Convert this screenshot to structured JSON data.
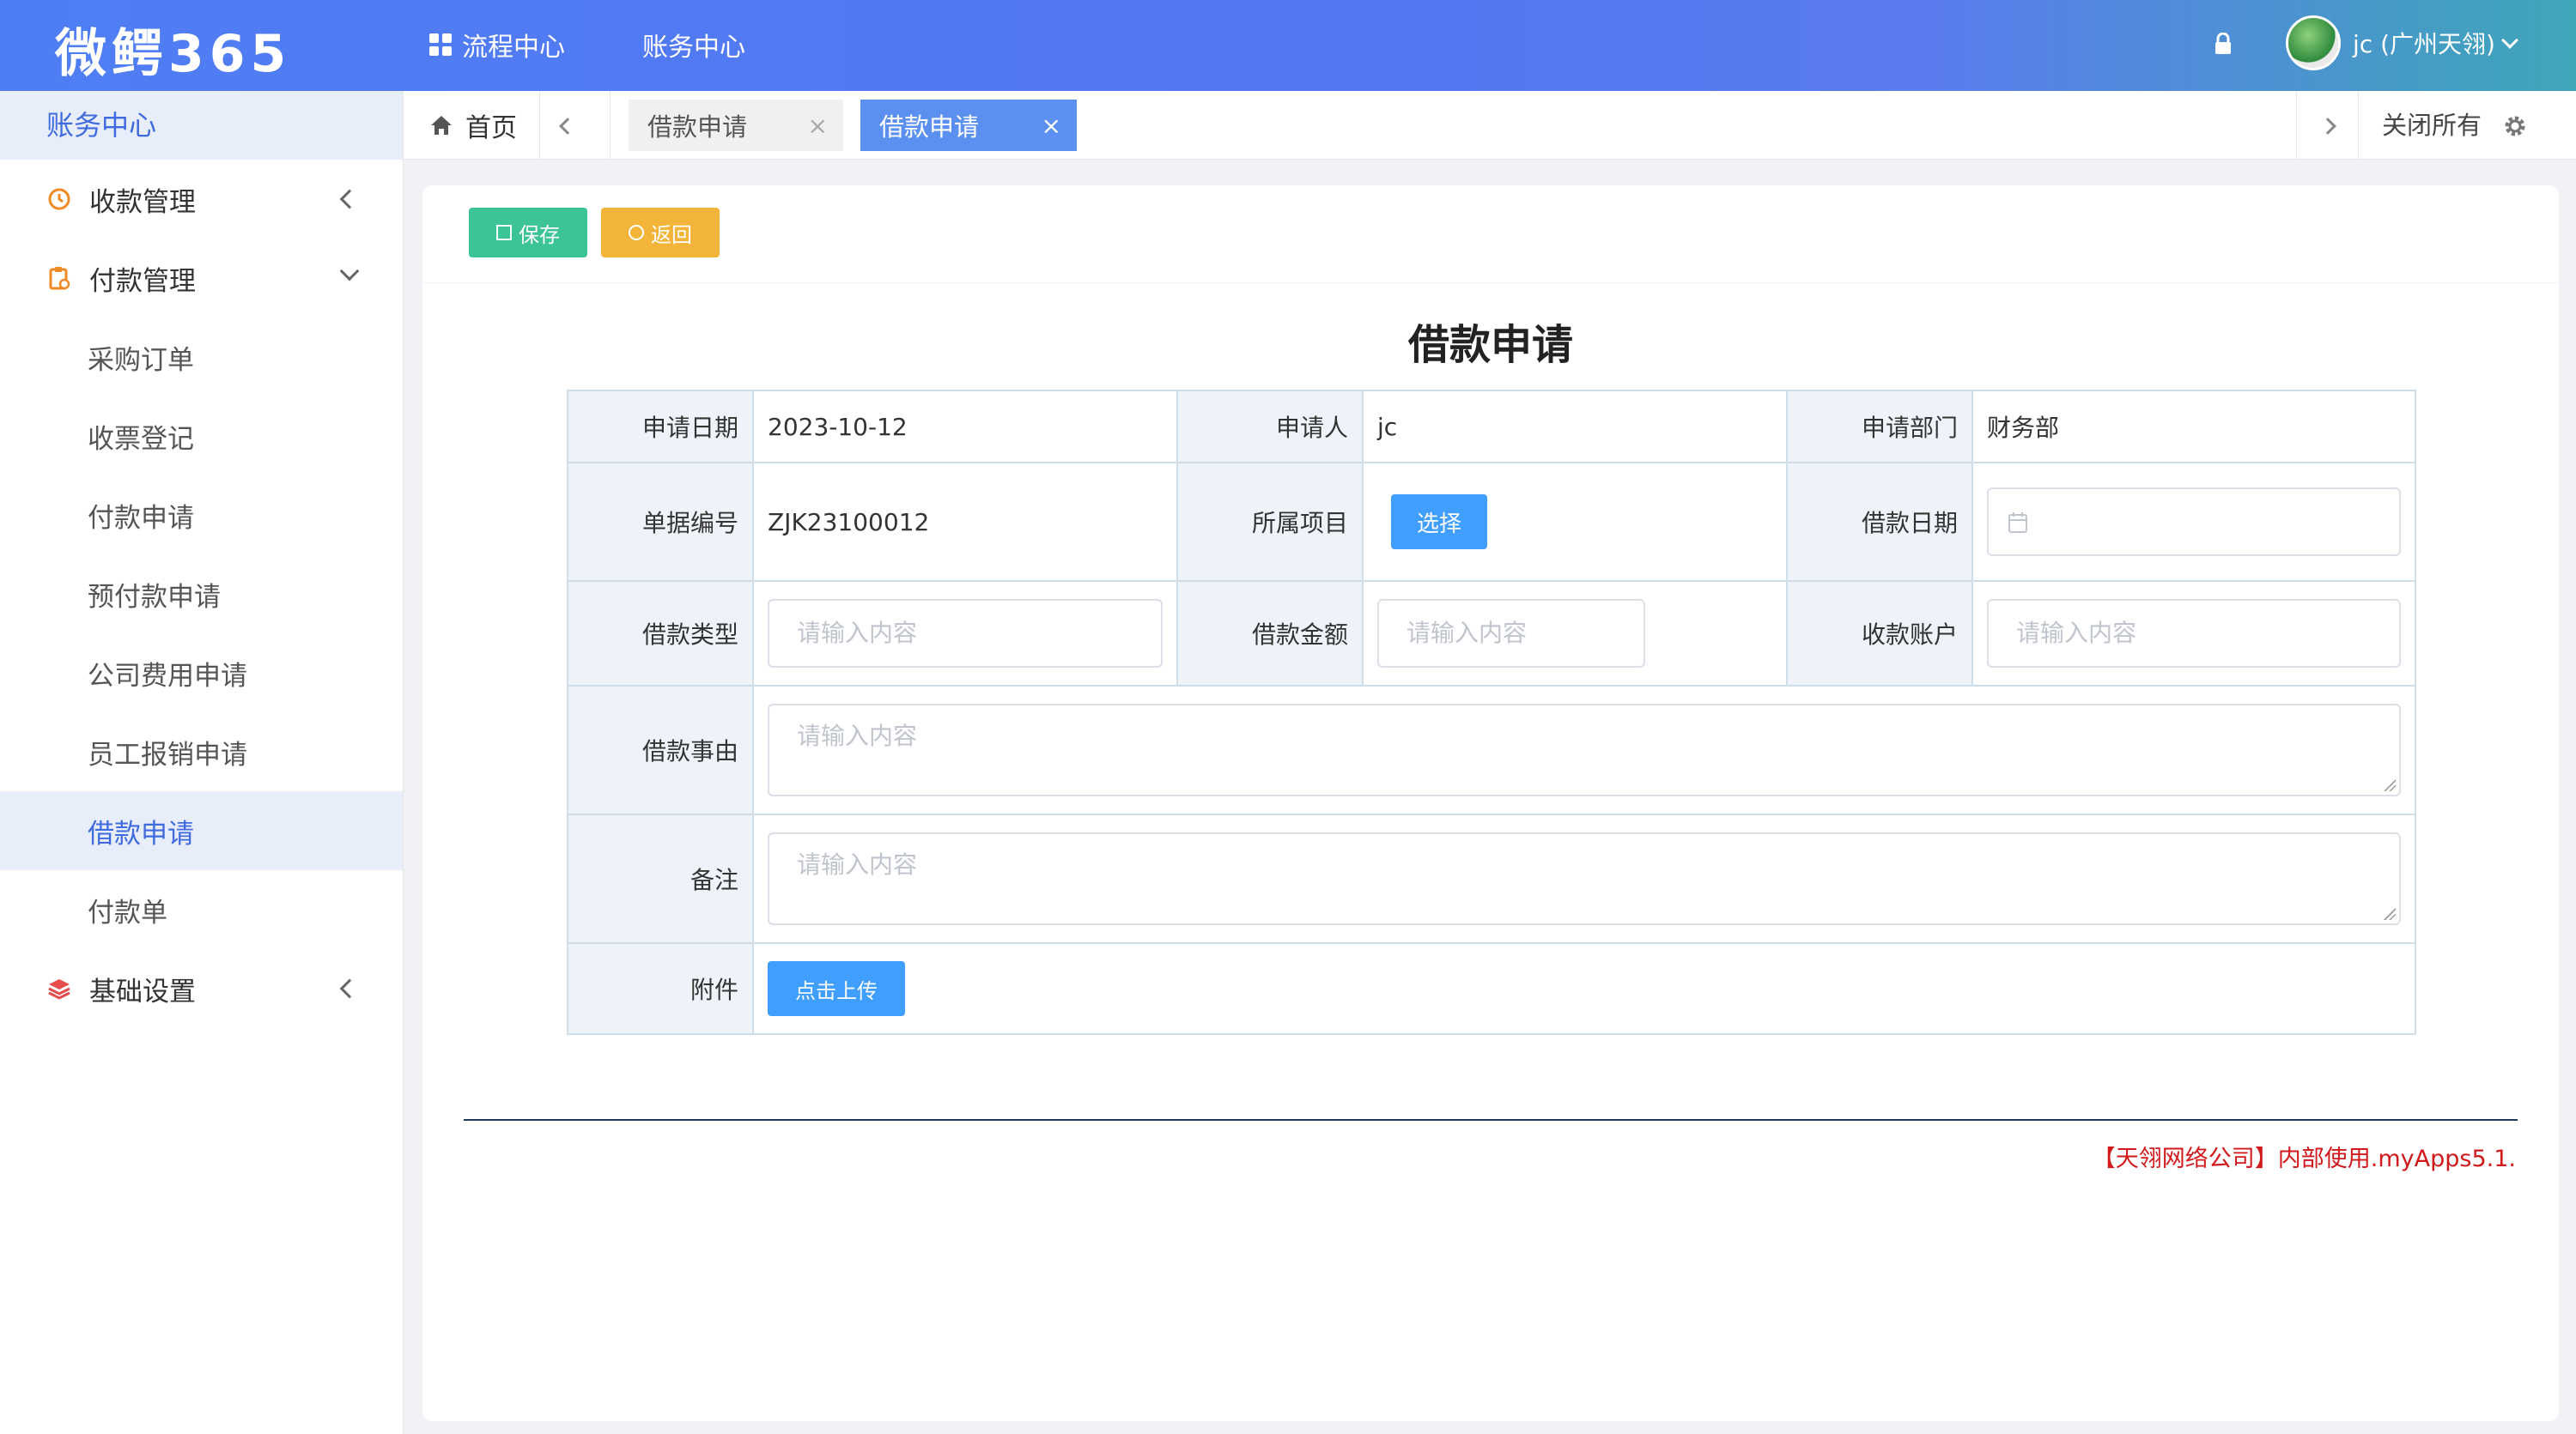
{
  "app": {
    "logo": "微鳄365"
  },
  "topnav": [
    {
      "label": "流程中心"
    },
    {
      "label": "账务中心"
    }
  ],
  "user": {
    "name": "jc (广州天翎)"
  },
  "sidebar": {
    "title": "账务中心",
    "items": [
      {
        "label": "收款管理"
      },
      {
        "label": "付款管理"
      },
      {
        "label": "采购订单"
      },
      {
        "label": "收票登记"
      },
      {
        "label": "付款申请"
      },
      {
        "label": "预付款申请"
      },
      {
        "label": "公司费用申请"
      },
      {
        "label": "员工报销申请"
      },
      {
        "label": "借款申请"
      },
      {
        "label": "付款单"
      },
      {
        "label": "基础设置"
      }
    ]
  },
  "tabs": {
    "home": "首页",
    "open": [
      {
        "label": "借款申请",
        "close": "×"
      },
      {
        "label": "借款申请",
        "close": "×"
      }
    ],
    "close_all": "关闭所有"
  },
  "toolbar": {
    "save": "保存",
    "back": "返回"
  },
  "form": {
    "title": "借款申请",
    "apply_date_label": "申请日期",
    "apply_date": "2023-10-12",
    "applicant_label": "申请人",
    "applicant": "jc",
    "dept_label": "申请部门",
    "dept": "财务部",
    "doc_no_label": "单据编号",
    "doc_no": "ZJK23100012",
    "project_label": "所属项目",
    "project_button": "选择",
    "loan_date_label": "借款日期",
    "loan_type_label": "借款类型",
    "amount_label": "借款金额",
    "account_label": "收款账户",
    "reason_label": "借款事由",
    "remark_label": "备注",
    "attach_label": "附件",
    "upload_button": "点击上传",
    "placeholder": "请输入内容"
  },
  "footer": {
    "text": "【天翎网络公司】内部使用.myApps5.1."
  },
  "colors": {
    "primary": "#409eff",
    "accent": "#3f6ae0",
    "save": "#3cc494",
    "back": "#f2b53a",
    "footer": "#d1191c"
  }
}
